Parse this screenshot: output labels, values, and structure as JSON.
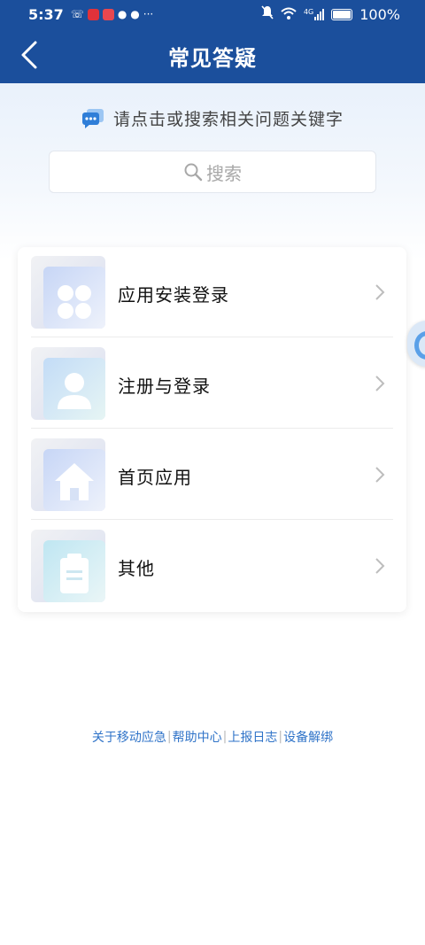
{
  "status_bar": {
    "time": "5:37",
    "network": "4G",
    "battery": "100%"
  },
  "header": {
    "title": "常见答疑"
  },
  "prompt": "请点击或搜索相关问题关键字",
  "search": {
    "placeholder": "搜索"
  },
  "menu": [
    {
      "label": "应用安装登录",
      "icon": "apps-grid-icon"
    },
    {
      "label": "注册与登录",
      "icon": "user-icon"
    },
    {
      "label": "首页应用",
      "icon": "home-icon"
    },
    {
      "label": "其他",
      "icon": "clipboard-icon"
    }
  ],
  "footer_links": [
    "关于移动应急",
    "帮助中心",
    "上报日志",
    "设备解绑"
  ]
}
